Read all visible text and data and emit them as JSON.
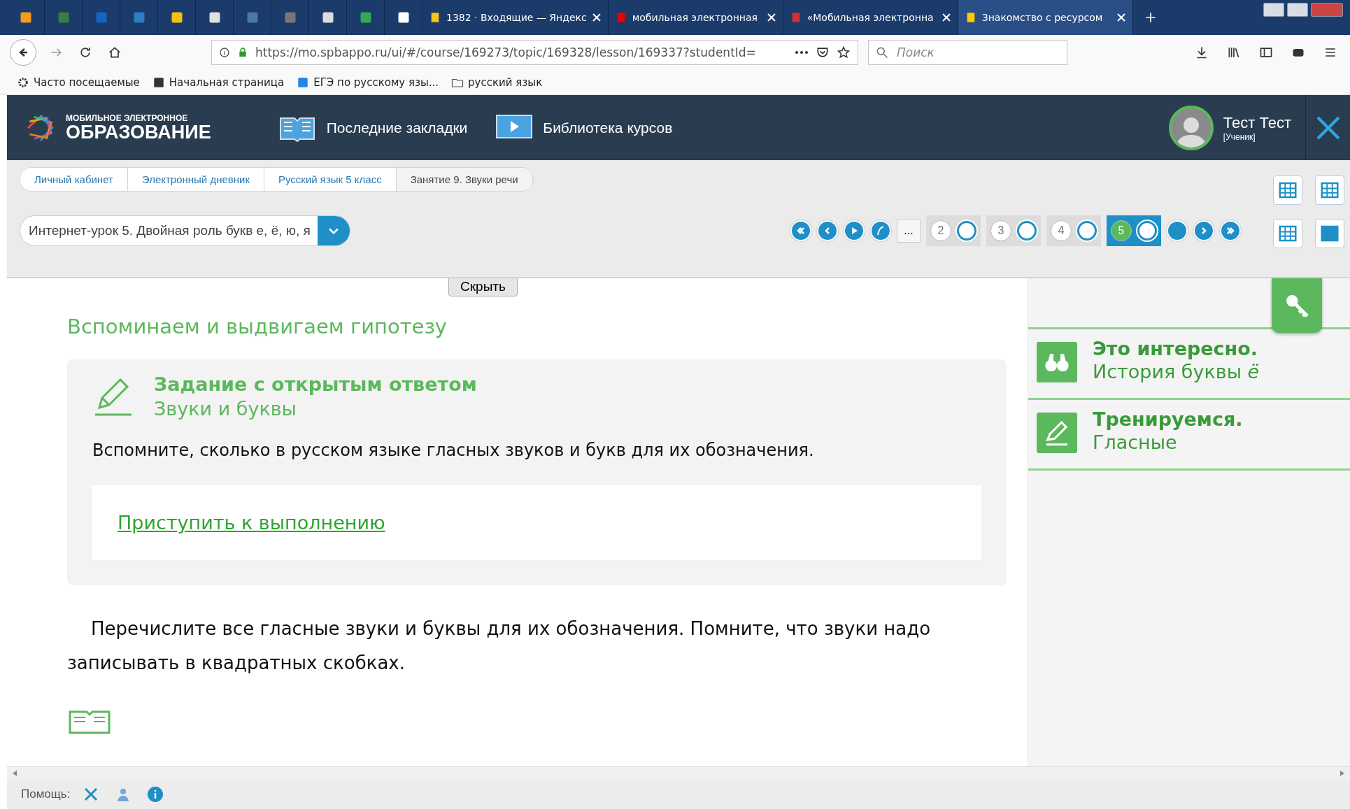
{
  "browser": {
    "tabs": [
      {
        "title": "1382 · Входящие — Яндекс",
        "selected": false
      },
      {
        "title": "мобильная электронная",
        "selected": false
      },
      {
        "title": "«Мобильная электронна",
        "selected": false
      },
      {
        "title": "Знакомство с ресурсом",
        "selected": true
      }
    ],
    "url": "https://mo.spbappo.ru/ui/#/course/169273/topic/169328/lesson/169337?studentId=",
    "search": {
      "placeholder": "Поиск"
    },
    "bookmarks": [
      "Часто посещаемые",
      "Начальная страница",
      "ЕГЭ по русскому язы...",
      "русский язык"
    ]
  },
  "header": {
    "logo_top": "МОБИЛЬНОЕ ЭЛЕКТРОННОЕ",
    "logo_bottom": "ОБРАЗОВАНИЕ",
    "nav": [
      "Последние закладки",
      "Библиотека курсов"
    ],
    "user_name": "Тест Тест",
    "user_role": "[Ученик]"
  },
  "breadcrumbs": [
    {
      "label": "Личный кабинет",
      "selected": false
    },
    {
      "label": "Электронный дневник",
      "selected": false
    },
    {
      "label": "Русский язык 5 класс",
      "selected": false
    },
    {
      "label": "Занятие 9. Звуки речи",
      "selected": true
    }
  ],
  "lesson_select": {
    "value": "Интернет-урок 5. Двойная роль букв е, ё, ю, я"
  },
  "pager": {
    "more": "...",
    "pages": [
      {
        "label": "2",
        "selected": false
      },
      {
        "label": "3",
        "selected": false
      },
      {
        "label": "4",
        "selected": false
      },
      {
        "label": "5",
        "selected": true
      }
    ]
  },
  "hide_button": "Скрыть",
  "content": {
    "section_title": "Вспоминаем и выдвигаем гипотезу",
    "task": {
      "title": "Задание с открытым ответом",
      "subtitle": "Звуки и буквы",
      "text": "Вспомните, сколько в русском языке гласных звуков и букв для их обозначения.",
      "link": "Приступить к выполнению"
    },
    "paragraph": "Перечислите все гласные звуки и буквы для их обозначения. Помните, что звуки надо записывать в квадратных скобках."
  },
  "side_panel": [
    {
      "kind": "interesting",
      "title": "Это интересно.",
      "subtitle": "История буквы *ё*"
    },
    {
      "kind": "training",
      "title": "Тренируемся.",
      "subtitle": "Гласные"
    }
  ],
  "status_bar": {
    "label": "Помощь:"
  }
}
